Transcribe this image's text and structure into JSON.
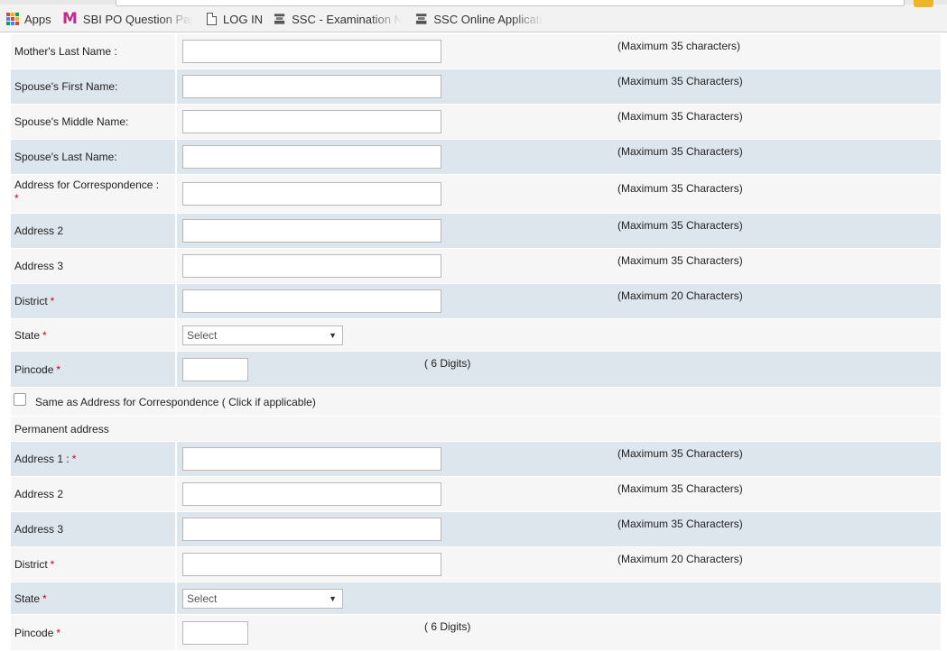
{
  "bookmarks": [
    {
      "label": "Apps",
      "icon": "apps-grid-icon"
    },
    {
      "label": "SBI PO Question Pape",
      "icon": "m-logo-icon"
    },
    {
      "label": "LOG IN",
      "icon": "document-icon"
    },
    {
      "label": "SSC - Examination No",
      "icon": "emblem-icon"
    },
    {
      "label": "SSC Online Applicatio",
      "icon": "emblem-icon"
    }
  ],
  "form": {
    "mother_last_name": {
      "label": "Mother's Last Name :",
      "value": "",
      "hint": "(Maximum 35 characters)"
    },
    "spouse_first_name": {
      "label": "Spouse's First Name:",
      "value": "",
      "hint": "(Maximum 35 Characters)"
    },
    "spouse_middle_name": {
      "label": "Spouse's Middle Name:",
      "value": "",
      "hint": "(Maximum 35 Characters)"
    },
    "spouse_last_name": {
      "label": "Spouse's Last Name:",
      "value": "",
      "hint": "(Maximum 35 Characters)"
    },
    "corr_address1": {
      "label": "Address for Correspondence :",
      "required": "*",
      "value": "",
      "hint": "(Maximum 35 Characters)"
    },
    "corr_address2": {
      "label": "Address 2",
      "value": "",
      "hint": "(Maximum 35 Characters)"
    },
    "corr_address3": {
      "label": "Address 3",
      "value": "",
      "hint": "(Maximum 35 Characters)"
    },
    "corr_district": {
      "label": "District",
      "required": "*",
      "value": "",
      "hint": "(Maximum 20 Characters)"
    },
    "corr_state": {
      "label": "State",
      "required": "*",
      "selected": "Select"
    },
    "corr_pincode": {
      "label": "Pincode",
      "required": "*",
      "value": "",
      "hint": "( 6 Digits)"
    },
    "same_as_label": "Same as Address for Correspondence ( Click if applicable)",
    "permanent_heading": "Permanent address",
    "perm_address1": {
      "label": "Address 1 :",
      "required": "*",
      "value": "",
      "hint": "(Maximum 35 Characters)"
    },
    "perm_address2": {
      "label": "Address 2",
      "value": "",
      "hint": "(Maximum 35 Characters)"
    },
    "perm_address3": {
      "label": "Address 3",
      "value": "",
      "hint": "(Maximum 35 Characters)"
    },
    "perm_district": {
      "label": "District",
      "required": "*",
      "value": "",
      "hint": "(Maximum 20 Characters)"
    },
    "perm_state": {
      "label": "State",
      "required": "*",
      "selected": "Select"
    },
    "perm_pincode": {
      "label": "Pincode",
      "required": "*",
      "value": "",
      "hint": "( 6 Digits)"
    }
  },
  "colors": {
    "row_light": "#f6f6f6",
    "row_blue": "#dde5ed",
    "required": "#d0021b",
    "m_logo": "#c62a8c"
  }
}
